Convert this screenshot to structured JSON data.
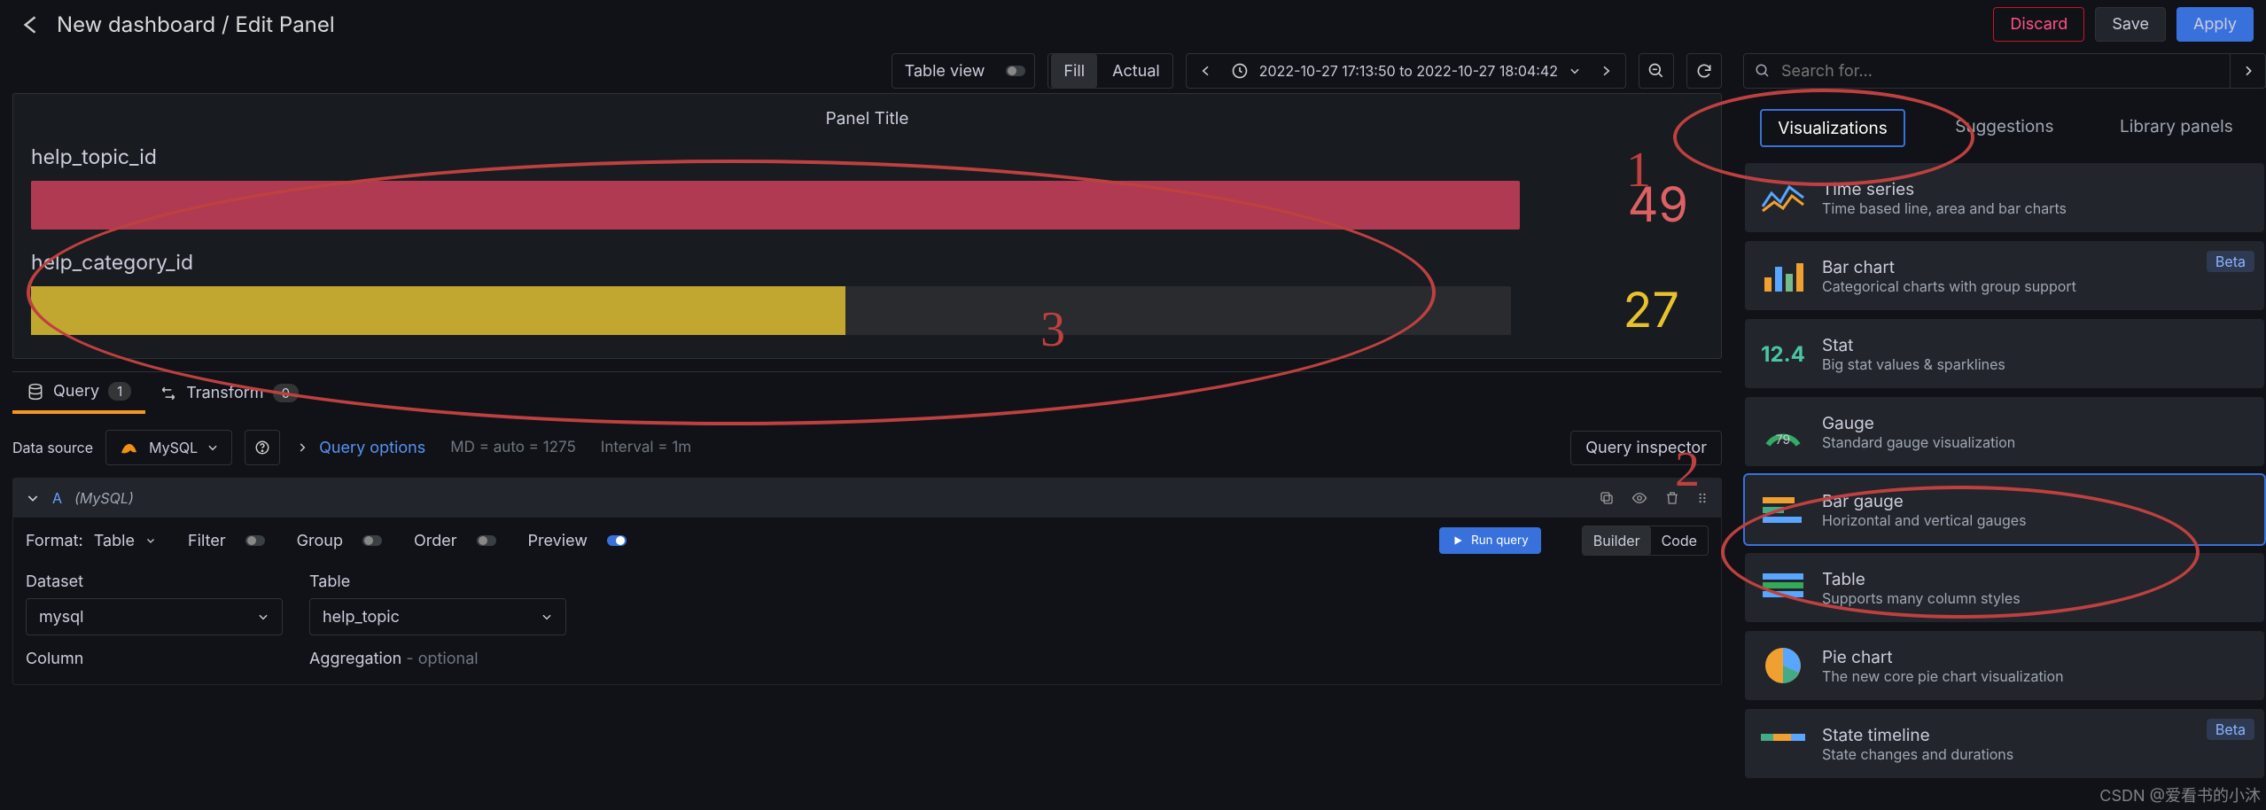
{
  "header": {
    "breadcrumb": "New dashboard / Edit Panel",
    "discard": "Discard",
    "save": "Save",
    "apply": "Apply"
  },
  "toolbar": {
    "table_view": "Table view",
    "fill": "Fill",
    "actual": "Actual",
    "time_range": "2022-10-27 17:13:50 to 2022-10-27 18:04:42"
  },
  "panel": {
    "title": "Panel Title",
    "gauges": [
      {
        "label": "help_topic_id",
        "value": "49",
        "fill_pct": 100,
        "color": "#b03a52"
      },
      {
        "label": "help_category_id",
        "value": "27",
        "fill_pct": 55,
        "color": "#c1a730"
      }
    ]
  },
  "tabs": {
    "query_label": "Query",
    "query_count": "1",
    "transform_label": "Transform",
    "transform_count": "0"
  },
  "ds": {
    "label": "Data source",
    "value": "MySQL",
    "query_options": "Query options",
    "md": "MD = auto = 1275",
    "interval": "Interval = 1m",
    "inspector": "Query inspector"
  },
  "query": {
    "name": "A",
    "engine": "(MySQL)",
    "format_label": "Format:",
    "format_value": "Table",
    "filter": "Filter",
    "group": "Group",
    "order": "Order",
    "preview": "Preview",
    "preview_on": true,
    "run": "Run query",
    "builder": "Builder",
    "code": "Code",
    "dataset_label": "Dataset",
    "dataset_value": "mysql",
    "table_label": "Table",
    "table_value": "help_topic",
    "column_label": "Column",
    "agg_label": "Aggregation",
    "agg_optional": " - optional"
  },
  "search": {
    "placeholder": "Search for..."
  },
  "viz_tabs": {
    "visualizations": "Visualizations",
    "suggestions": "Suggestions",
    "library": "Library panels"
  },
  "viz_list": [
    {
      "title": "Time series",
      "desc": "Time based line, area and bar charts"
    },
    {
      "title": "Bar chart",
      "desc": "Categorical charts with group support",
      "beta": "Beta"
    },
    {
      "title": "Stat",
      "desc": "Big stat values & sparklines"
    },
    {
      "title": "Gauge",
      "desc": "Standard gauge visualization"
    },
    {
      "title": "Bar gauge",
      "desc": "Horizontal and vertical gauges",
      "selected": true
    },
    {
      "title": "Table",
      "desc": "Supports many column styles"
    },
    {
      "title": "Pie chart",
      "desc": "The new core pie chart visualization"
    },
    {
      "title": "State timeline",
      "desc": "State changes and durations",
      "beta": "Beta"
    }
  ],
  "annotations": {
    "n1": "1",
    "n2": "2",
    "n3": "3"
  },
  "watermark": "CSDN @爱看书的小沐",
  "chart_data": {
    "type": "bar",
    "orientation": "horizontal",
    "categories": [
      "help_topic_id",
      "help_category_id"
    ],
    "values": [
      49,
      27
    ],
    "title": "Panel Title",
    "xlim": [
      0,
      49
    ]
  }
}
